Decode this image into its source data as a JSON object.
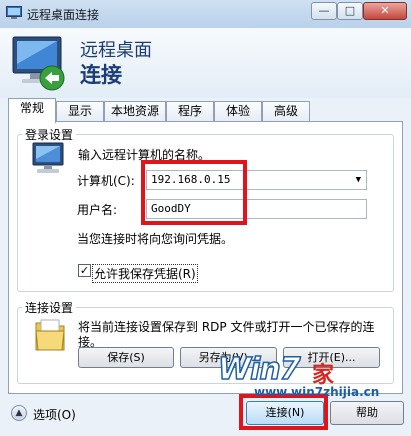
{
  "window": {
    "title": "远程桌面连接",
    "minimize_glyph": "—",
    "maximize_glyph": "□",
    "close_glyph": "✕"
  },
  "header": {
    "line1": "远程桌面",
    "line2": "连接"
  },
  "tabs": [
    {
      "label": "常规",
      "active": true
    },
    {
      "label": "显示",
      "active": false
    },
    {
      "label": "本地资源",
      "active": false
    },
    {
      "label": "程序",
      "active": false
    },
    {
      "label": "体验",
      "active": false
    },
    {
      "label": "高级",
      "active": false
    }
  ],
  "login_settings": {
    "title": "登录设置",
    "prompt": "输入远程计算机的名称。",
    "computer_label": "计算机(C):",
    "computer_value": "192.168.0.15",
    "username_label": "用户名:",
    "username_value": "GoodDY",
    "credentials_note": "当您连接时将向您询问凭据。",
    "save_credentials_label": "允许我保存凭据(R)",
    "save_credentials_checked": true
  },
  "connection_settings": {
    "title": "连接设置",
    "description_line1": "将当前连接设置保存到 RDP 文件或打开一个已保存的连",
    "description_line2": "接。",
    "save_button": "保存(S)",
    "save_as_button": "另存为(V)...",
    "open_button": "打开(E)..."
  },
  "footer": {
    "options_label": "选项(O)",
    "connect_button": "连接(N)",
    "help_button": "帮助"
  },
  "watermark": {
    "brand": "Win7",
    "site": "www.win7zhijia.cn",
    "suffix": "家"
  },
  "colors": {
    "highlight_red": "#e0141b",
    "title_blue": "#1c3c76"
  }
}
